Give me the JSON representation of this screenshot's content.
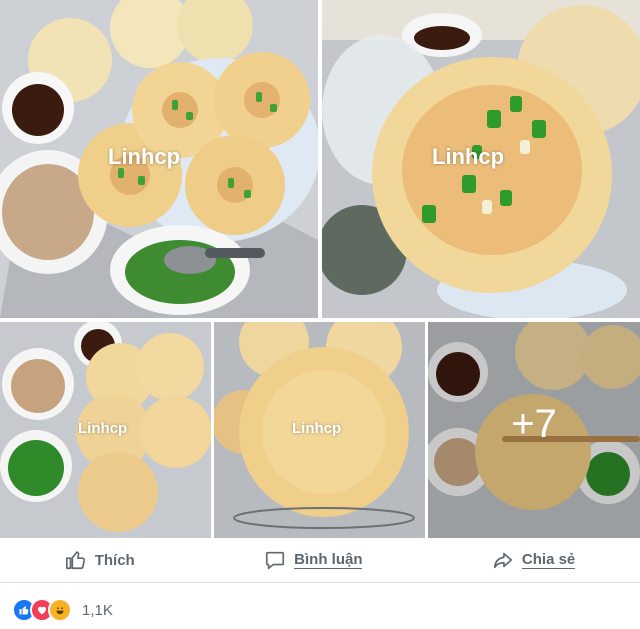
{
  "photos": {
    "watermark": "Linhcp",
    "more_count": "+7"
  },
  "actions": {
    "like": "Thích",
    "comment": "Bình luận",
    "share": "Chia sẻ"
  },
  "reactions": {
    "count": "1,1K",
    "icons": [
      "like-icon",
      "love-icon",
      "haha-icon"
    ]
  },
  "colors": {
    "like_blue": "#1877f2",
    "love_red": "#f33e58",
    "haha_yellow": "#f7b125",
    "action_gray": "#606770"
  }
}
